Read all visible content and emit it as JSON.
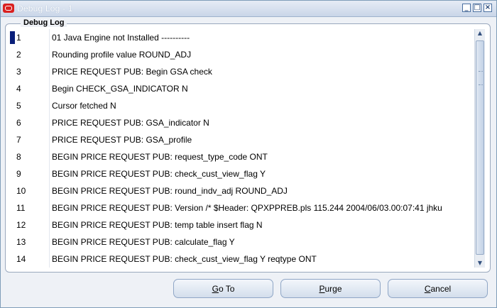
{
  "window": {
    "title": "Debug Log - 1"
  },
  "groupbox": {
    "label": "Debug Log"
  },
  "log_rows": [
    {
      "num": "1",
      "msg": "01 Java Engine not Installed ----------"
    },
    {
      "num": "2",
      "msg": "Rounding profile value ROUND_ADJ"
    },
    {
      "num": "3",
      "msg": "PRICE REQUEST PUB: Begin GSA check"
    },
    {
      "num": "4",
      "msg": "Begin CHECK_GSA_INDICATOR N"
    },
    {
      "num": "5",
      "msg": "Cursor fetched N"
    },
    {
      "num": "6",
      "msg": "PRICE REQUEST PUB: GSA_indicator N"
    },
    {
      "num": "7",
      "msg": "PRICE REQUEST PUB: GSA_profile"
    },
    {
      "num": "8",
      "msg": "BEGIN PRICE REQUEST PUB: request_type_code ONT"
    },
    {
      "num": "9",
      "msg": "BEGIN PRICE REQUEST PUB: check_cust_view_flag Y"
    },
    {
      "num": "10",
      "msg": "BEGIN PRICE REQUEST PUB: round_indv_adj ROUND_ADJ"
    },
    {
      "num": "11",
      "msg": "BEGIN PRICE REQUEST PUB: Version /* $Header: QPXPPREB.pls 115.244 2004/06/03.00:07:41 jhku"
    },
    {
      "num": "12",
      "msg": "BEGIN PRICE REQUEST PUB: temp table insert flag N"
    },
    {
      "num": "13",
      "msg": "BEGIN PRICE REQUEST PUB: calculate_flag Y"
    },
    {
      "num": "14",
      "msg": "BEGIN PRICE REQUEST PUB: check_cust_view_flag Y reqtype ONT"
    }
  ],
  "buttons": {
    "goto": {
      "mnemonic": "G",
      "rest": "o To"
    },
    "purge": {
      "mnemonic": "P",
      "rest": "urge"
    },
    "cancel": {
      "mnemonic": "C",
      "rest": "ancel"
    }
  },
  "colors": {
    "selection": "#0a1f7a",
    "titlebar": "#c9d6e8",
    "button_border": "#8fa6c6"
  },
  "icons": [
    "oracle-logo-icon",
    "minimize-icon",
    "maximize-icon",
    "close-icon",
    "scroll-up-icon",
    "scroll-down-icon"
  ]
}
